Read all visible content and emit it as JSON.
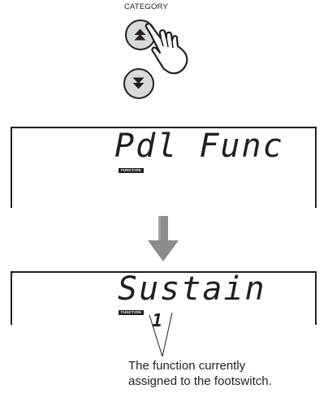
{
  "labels": {
    "category": "CATEGORY"
  },
  "panel_top": {
    "text": "Pdl Func",
    "badge": "FUNCTION"
  },
  "panel_bottom": {
    "text": "Sustain",
    "badge": "FUNCTION",
    "number": "1"
  },
  "caption": {
    "line1": "The function currently",
    "line2": "assigned to the footswitch."
  },
  "colors": {
    "ink": "#231f20",
    "button_fill": "#d9d9d9",
    "arrow_fill": "#8c8c8c"
  },
  "icons": {
    "up_button": "double-chevron-up-icon",
    "down_button": "double-chevron-down-icon",
    "hand": "pointing-hand-icon",
    "arrow": "down-arrow-icon"
  }
}
